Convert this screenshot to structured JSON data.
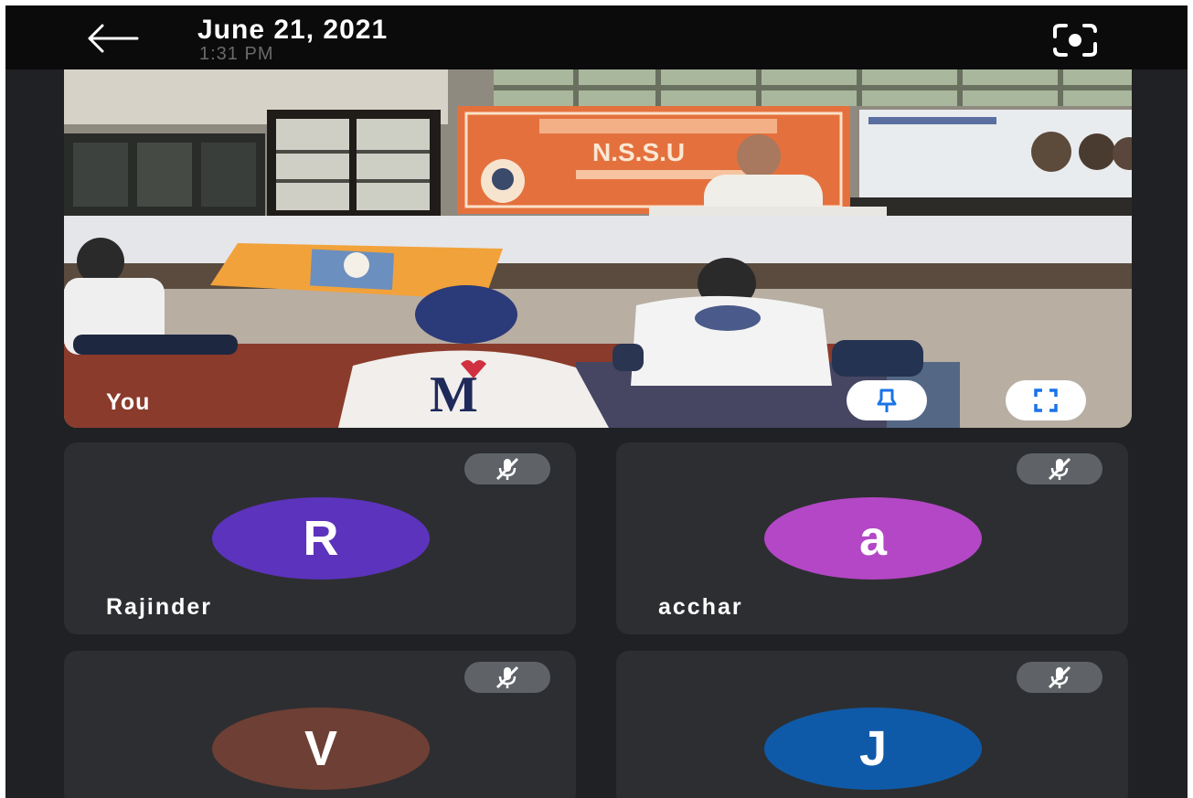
{
  "header": {
    "date": "June 21, 2021",
    "time": "1:31 PM"
  },
  "self_tile": {
    "label": "You",
    "banner_text": "N.S.S.U"
  },
  "participants": [
    {
      "name": "Rajinder",
      "initial": "R",
      "color": "#5c33bc",
      "muted": true
    },
    {
      "name": "acchar",
      "initial": "a",
      "color": "#b347c6",
      "muted": true
    },
    {
      "name": "",
      "initial": "V",
      "color": "#6e3f34",
      "muted": true
    },
    {
      "name": "",
      "initial": "J",
      "color": "#0f5aa8",
      "muted": true
    }
  ],
  "colors": {
    "background": "#202124",
    "tile": "#2d2e31",
    "accent": "#1a73e8"
  }
}
